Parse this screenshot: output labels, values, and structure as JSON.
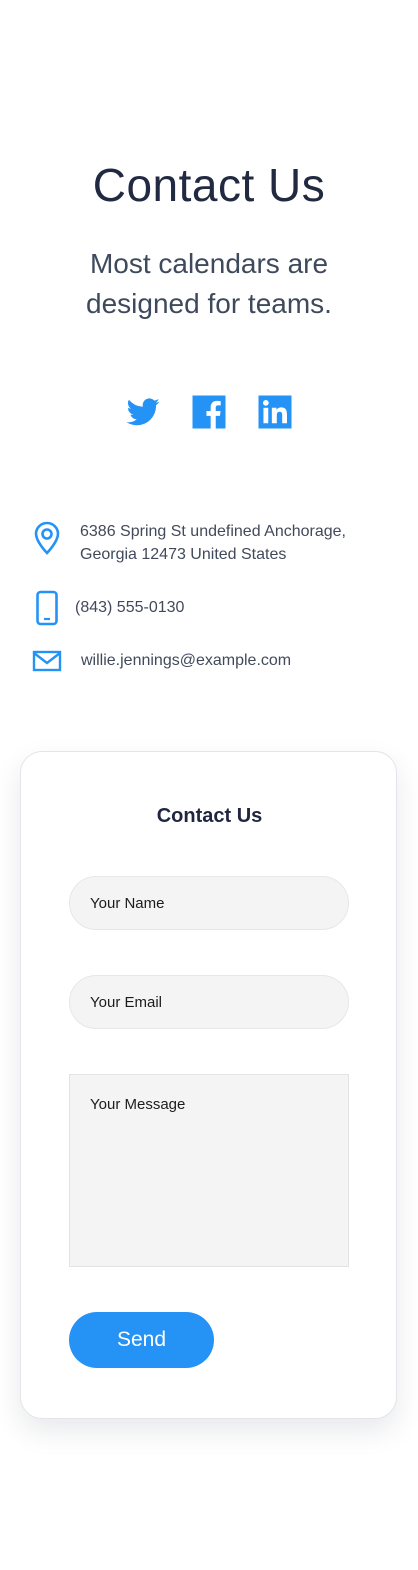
{
  "hero": {
    "title": "Contact Us",
    "subtitle": "Most calendars are designed for teams."
  },
  "social": [
    {
      "icon": "twitter-icon"
    },
    {
      "icon": "facebook-icon"
    },
    {
      "icon": "linkedin-icon"
    }
  ],
  "contact_info": {
    "address": "6386 Spring St undefined Anchorage, Georgia 12473 United States",
    "phone": "(843) 555-0130",
    "email": "willie.jennings@example.com"
  },
  "form": {
    "title": "Contact Us",
    "name_placeholder": "Your Name",
    "email_placeholder": "Your Email",
    "message_placeholder": "Your Message",
    "send_label": "Send"
  },
  "colors": {
    "accent": "#2592f6",
    "heading": "#222a42",
    "text": "#414a5b"
  }
}
